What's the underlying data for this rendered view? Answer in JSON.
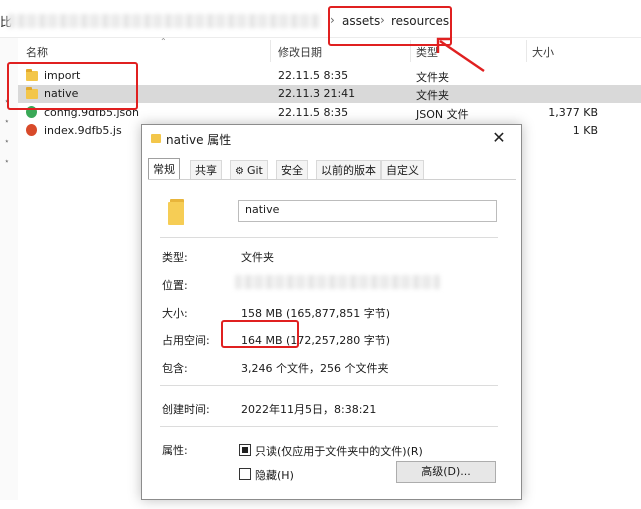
{
  "path_bar": {
    "clipped_prefix": "比",
    "crumbs": [
      "assets",
      "resources"
    ],
    "separator": "›"
  },
  "columns": {
    "name": "名称",
    "modified": "修改日期",
    "type": "类型",
    "size": "大小"
  },
  "files": [
    {
      "name": "import",
      "date": "22.11.5 8:35",
      "type": "文件夹",
      "size": "",
      "icon": "folder-icon"
    },
    {
      "name": "native",
      "date": "22.11.3 21:41",
      "type": "文件夹",
      "size": "",
      "icon": "folder-icon"
    },
    {
      "name": "config.9dfb5.json",
      "date": "22.11.5 8:35",
      "type": "JSON 文件",
      "size": "1,377 KB",
      "icon": "json-file-icon"
    },
    {
      "name": "index.9dfb5.js",
      "date": "",
      "type": "",
      "size": "1 KB",
      "icon": "js-file-icon"
    }
  ],
  "dialog": {
    "title": "native 属性",
    "close_glyph": "✕",
    "tabs": [
      "常规",
      "共享",
      "Git",
      "安全",
      "以前的版本",
      "自定义"
    ],
    "active_tab": "常规",
    "folder_name": "native",
    "props": {
      "type_label": "类型:",
      "type_value": "文件夹",
      "location_label": "位置:",
      "size_label": "大小:",
      "size_value": "158 MB (165,877,851 字节)",
      "disk_label": "占用空间:",
      "disk_value": "164 MB (172,257,280 字节)",
      "contains_label": "包含:",
      "contains_value": "3,246 个文件，256 个文件夹",
      "created_label": "创建时间:",
      "created_value": "2022年11月5日，8:38:21",
      "attributes_label": "属性:",
      "readonly_label": "只读(仅应用于文件夹中的文件)(R)",
      "hidden_label": "隐藏(H)",
      "advanced_label": "高级(D)..."
    }
  },
  "colors": {
    "highlight": "#e02020",
    "selected_row": "#d9d9d9",
    "folder": "#f3c64a"
  }
}
